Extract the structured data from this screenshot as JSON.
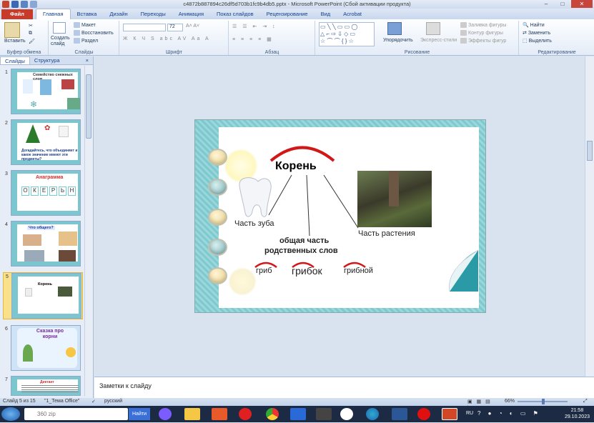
{
  "window": {
    "title": "c4872b887894c26df5d703b1fc9b4db5.pptx - Microsoft PowerPoint (Сбой активации продукта)"
  },
  "tabs": [
    "Файл",
    "Главная",
    "Вставка",
    "Дизайн",
    "Переходы",
    "Анимация",
    "Показ слайдов",
    "Рецензирование",
    "Вид",
    "Acrobat"
  ],
  "ribbon": {
    "clipboard": {
      "paste": "Вставить",
      "group": "Буфер обмена"
    },
    "slides": {
      "create": "Создать слайд",
      "layout": "Макет",
      "reset": "Восстановить",
      "section": "Раздел",
      "group": "Слайды"
    },
    "font": {
      "size": "72",
      "group": "Шрифт"
    },
    "paragraph": {
      "group": "Абзац"
    },
    "drawing": {
      "arrange": "Упорядочить",
      "styles": "Экспресс-стили",
      "fill": "Заливка фигуры",
      "outline": "Контур фигуры",
      "effects": "Эффекты фигур",
      "group": "Рисование"
    },
    "editing": {
      "find": "Найти",
      "replace": "Заменить",
      "select": "Выделить",
      "group": "Редактирование"
    }
  },
  "panel": {
    "tab_slides": "Слайды",
    "tab_outline": "Структура",
    "close": "×"
  },
  "thumbnails": [
    {
      "num": "1",
      "title": "Семейство снежных слов"
    },
    {
      "num": "2",
      "title": "Догадайтесь, что объединяет и какое значение имеют эти предметы?"
    },
    {
      "num": "3",
      "title": "Анаграмма",
      "letters": [
        "О",
        "К",
        "Е",
        "Р",
        "Ь",
        "Н"
      ]
    },
    {
      "num": "4",
      "title": "Что общего?"
    },
    {
      "num": "5",
      "title": "Корень"
    },
    {
      "num": "6",
      "title": "Сказка про корни"
    },
    {
      "num": "7",
      "title": "Диктант"
    }
  ],
  "slide": {
    "title": "Корень",
    "label_tooth": "Часть зуба",
    "label_plant": "Часть растения",
    "center_line1": "общая часть",
    "center_line2": "родственных слов",
    "words": [
      "гриб",
      "грибок",
      "грибной"
    ]
  },
  "notes": {
    "placeholder": "Заметки к слайду"
  },
  "status": {
    "slide": "Слайд 5 из 15",
    "theme": "\"1_Тема Office\"",
    "lang": "русский",
    "zoom": "66%"
  },
  "taskbar": {
    "search": "360 zip",
    "find": "Найти",
    "time": "21:58",
    "date": "29.10.2023",
    "lang": "RU"
  }
}
